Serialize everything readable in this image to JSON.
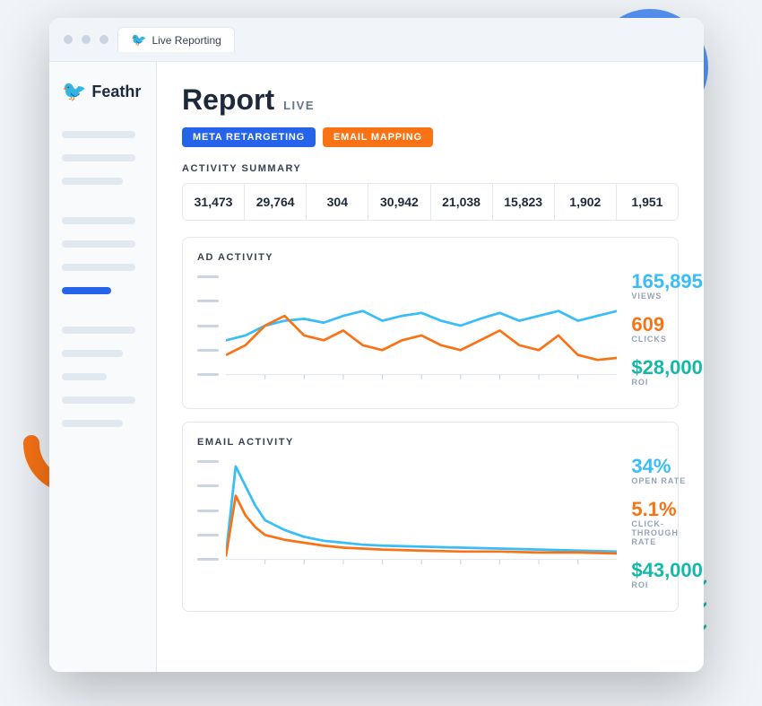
{
  "browser": {
    "tab_icon": "🐦",
    "tab_label": "Live Reporting"
  },
  "sidebar": {
    "logo_text": "Feathr",
    "lines": [
      "long",
      "long",
      "long",
      "long",
      "highlight",
      "long",
      "medium",
      "short",
      "long",
      "medium"
    ]
  },
  "report": {
    "title": "Report",
    "live_label": "LIVE",
    "tag_meta": "META RETARGETING",
    "tag_email": "EMAIL MAPPING"
  },
  "activity_summary": {
    "section_title": "ACTIVITY SUMMARY",
    "values": [
      "31,473",
      "29,764",
      "304",
      "30,942",
      "21,038",
      "15,823",
      "1,902",
      "1,951"
    ]
  },
  "ad_activity": {
    "section_title": "AD ACTIVITY",
    "views_value": "165,895",
    "views_label": "VIEWS",
    "clicks_value": "609",
    "clicks_label": "CLICKS",
    "roi_value": "$28,000",
    "roi_label": "ROI"
  },
  "email_activity": {
    "section_title": "EMAIL ACTIVITY",
    "open_rate_value": "34%",
    "open_rate_label": "OPEN RATE",
    "ctr_value": "5.1%",
    "ctr_label": "CLICK-THROUGH RATE",
    "roi_value": "$43,000",
    "roi_label": "ROI"
  }
}
